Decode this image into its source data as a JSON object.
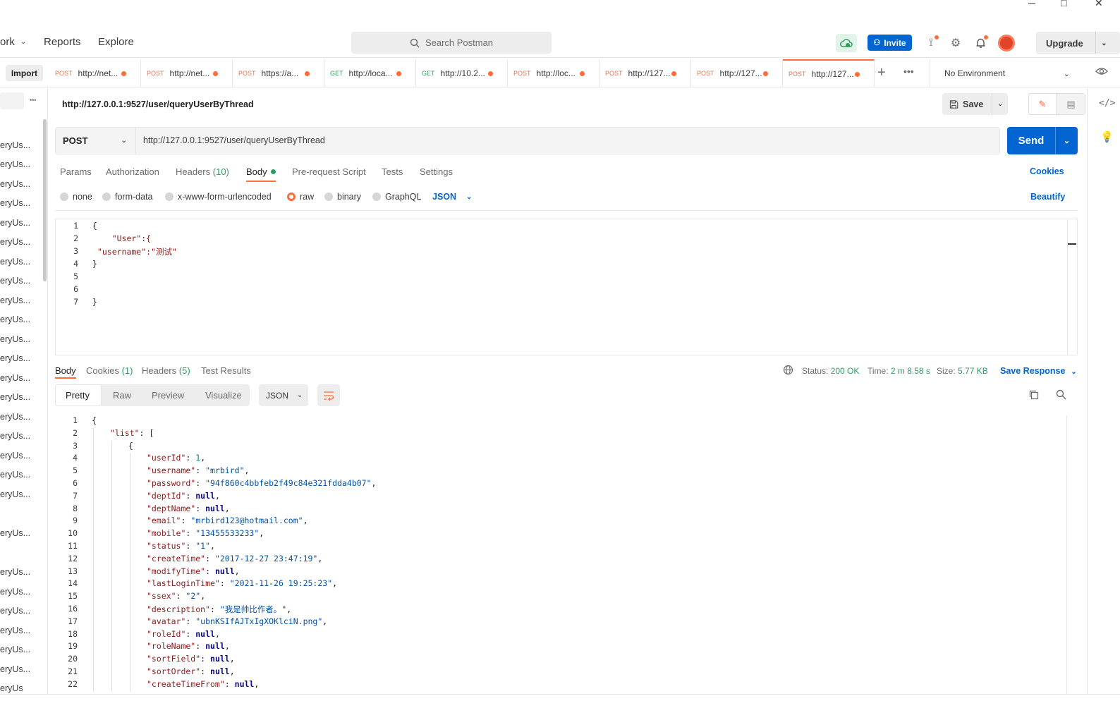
{
  "window": {
    "minimize": "─",
    "maximize": "□",
    "close": "✕"
  },
  "header": {
    "workspace": "ork",
    "reports": "Reports",
    "explore": "Explore",
    "search_placeholder": "Search Postman",
    "invite": "Invite",
    "upgrade": "Upgrade"
  },
  "tabs": {
    "import": "Import",
    "items": [
      {
        "method": "POST",
        "url": "http://net...",
        "type": "post"
      },
      {
        "method": "POST",
        "url": "http://net...",
        "type": "post"
      },
      {
        "method": "POST",
        "url": "https://a...",
        "type": "post"
      },
      {
        "method": "GET",
        "url": "http://loca...",
        "type": "get"
      },
      {
        "method": "GET",
        "url": "http://10.2...",
        "type": "get"
      },
      {
        "method": "POST",
        "url": "http://loc...",
        "type": "post"
      },
      {
        "method": "POST",
        "url": "http://127...",
        "type": "post"
      },
      {
        "method": "POST",
        "url": "http://127...",
        "type": "post"
      },
      {
        "method": "POST",
        "url": "http://127...",
        "type": "post"
      }
    ],
    "environment": "No Environment"
  },
  "sidebar": {
    "item_label": "eryUs...",
    "items": [
      "eryUs...",
      "eryUs...",
      "eryUs...",
      "eryUs...",
      "eryUs...",
      "eryUs...",
      "eryUs...",
      "eryUs...",
      "eryUs...",
      "eryUs...",
      "eryUs...",
      "eryUs...",
      "eryUs...",
      "eryUs...",
      "eryUs...",
      "eryUs...",
      "eryUs...",
      "eryUs...",
      "eryUs...",
      "eryUs...",
      "eryUs...",
      "eryUs...",
      "eryUs...",
      "eryUs...",
      "eryUs...",
      "eryUs..."
    ],
    "last": "eryUs"
  },
  "request": {
    "title": "http://127.0.0.1:9527/user/queryUserByThread",
    "save": "Save",
    "method": "POST",
    "url": "http://127.0.0.1:9527/user/queryUserByThread",
    "send": "Send",
    "tabs": {
      "params": "Params",
      "authorization": "Authorization",
      "headers": "Headers",
      "headers_count": "(10)",
      "body": "Body",
      "prerequest": "Pre-request Script",
      "tests": "Tests",
      "settings": "Settings",
      "cookies": "Cookies"
    },
    "body_types": {
      "none": "none",
      "formdata": "form-data",
      "urlencoded": "x-www-form-urlencoded",
      "raw": "raw",
      "binary": "binary",
      "graphql": "GraphQL",
      "json": "JSON",
      "beautify": "Beautify"
    },
    "body_lines": [
      "{",
      "    \"User\":{",
      " \"username\":\"测试\"",
      "}",
      "    ",
      "",
      "}"
    ]
  },
  "response": {
    "tabs": {
      "body": "Body",
      "cookies": "Cookies",
      "cookies_count": "(1)",
      "headers": "Headers",
      "headers_count": "(5)",
      "test_results": "Test Results"
    },
    "status_label": "Status:",
    "status": "200 OK",
    "time_label": "Time:",
    "time": "2 m 8.58 s",
    "size_label": "Size:",
    "size": "5.77 KB",
    "save_response": "Save Response",
    "views": {
      "pretty": "Pretty",
      "raw": "Raw",
      "preview": "Preview",
      "visualize": "Visualize",
      "format": "JSON"
    },
    "lines": [
      {
        "i": 0,
        "t": [
          [
            "p",
            "{"
          ]
        ]
      },
      {
        "i": 1,
        "t": [
          [
            "k",
            "\"list\""
          ],
          [
            "p",
            ": ["
          ]
        ]
      },
      {
        "i": 2,
        "t": [
          [
            "p",
            "{"
          ]
        ]
      },
      {
        "i": 3,
        "t": [
          [
            "k",
            "\"userId\""
          ],
          [
            "p",
            ": "
          ],
          [
            "n2",
            "1"
          ],
          [
            "p",
            ","
          ]
        ]
      },
      {
        "i": 3,
        "t": [
          [
            "k",
            "\"username\""
          ],
          [
            "p",
            ": "
          ],
          [
            "s",
            "\"mrbird\""
          ],
          [
            "p",
            ","
          ]
        ]
      },
      {
        "i": 3,
        "t": [
          [
            "k",
            "\"password\""
          ],
          [
            "p",
            ": "
          ],
          [
            "s",
            "\"94f860c4bbfeb2f49c84e321fdda4b07\""
          ],
          [
            "p",
            ","
          ]
        ]
      },
      {
        "i": 3,
        "t": [
          [
            "k",
            "\"deptId\""
          ],
          [
            "p",
            ": "
          ],
          [
            "n",
            "null"
          ],
          [
            "p",
            ","
          ]
        ]
      },
      {
        "i": 3,
        "t": [
          [
            "k",
            "\"deptName\""
          ],
          [
            "p",
            ": "
          ],
          [
            "n",
            "null"
          ],
          [
            "p",
            ","
          ]
        ]
      },
      {
        "i": 3,
        "t": [
          [
            "k",
            "\"email\""
          ],
          [
            "p",
            ": "
          ],
          [
            "s",
            "\"mrbird123@hotmail.com\""
          ],
          [
            "p",
            ","
          ]
        ]
      },
      {
        "i": 3,
        "t": [
          [
            "k",
            "\"mobile\""
          ],
          [
            "p",
            ": "
          ],
          [
            "s",
            "\"13455533233\""
          ],
          [
            "p",
            ","
          ]
        ]
      },
      {
        "i": 3,
        "t": [
          [
            "k",
            "\"status\""
          ],
          [
            "p",
            ": "
          ],
          [
            "s",
            "\"1\""
          ],
          [
            "p",
            ","
          ]
        ]
      },
      {
        "i": 3,
        "t": [
          [
            "k",
            "\"createTime\""
          ],
          [
            "p",
            ": "
          ],
          [
            "s",
            "\"2017-12-27 23:47:19\""
          ],
          [
            "p",
            ","
          ]
        ]
      },
      {
        "i": 3,
        "t": [
          [
            "k",
            "\"modifyTime\""
          ],
          [
            "p",
            ": "
          ],
          [
            "n",
            "null"
          ],
          [
            "p",
            ","
          ]
        ]
      },
      {
        "i": 3,
        "t": [
          [
            "k",
            "\"lastLoginTime\""
          ],
          [
            "p",
            ": "
          ],
          [
            "s",
            "\"2021-11-26 19:25:23\""
          ],
          [
            "p",
            ","
          ]
        ]
      },
      {
        "i": 3,
        "t": [
          [
            "k",
            "\"ssex\""
          ],
          [
            "p",
            ": "
          ],
          [
            "s",
            "\"2\""
          ],
          [
            "p",
            ","
          ]
        ]
      },
      {
        "i": 3,
        "t": [
          [
            "k",
            "\"description\""
          ],
          [
            "p",
            ": "
          ],
          [
            "s",
            "\"我是帅比作者。\""
          ],
          [
            "p",
            ","
          ]
        ]
      },
      {
        "i": 3,
        "t": [
          [
            "k",
            "\"avatar\""
          ],
          [
            "p",
            ": "
          ],
          [
            "s",
            "\"ubnKSIfAJTxIgXOKlciN.png\""
          ],
          [
            "p",
            ","
          ]
        ]
      },
      {
        "i": 3,
        "t": [
          [
            "k",
            "\"roleId\""
          ],
          [
            "p",
            ": "
          ],
          [
            "n",
            "null"
          ],
          [
            "p",
            ","
          ]
        ]
      },
      {
        "i": 3,
        "t": [
          [
            "k",
            "\"roleName\""
          ],
          [
            "p",
            ": "
          ],
          [
            "n",
            "null"
          ],
          [
            "p",
            ","
          ]
        ]
      },
      {
        "i": 3,
        "t": [
          [
            "k",
            "\"sortField\""
          ],
          [
            "p",
            ": "
          ],
          [
            "n",
            "null"
          ],
          [
            "p",
            ","
          ]
        ]
      },
      {
        "i": 3,
        "t": [
          [
            "k",
            "\"sortOrder\""
          ],
          [
            "p",
            ": "
          ],
          [
            "n",
            "null"
          ],
          [
            "p",
            ","
          ]
        ]
      },
      {
        "i": 3,
        "t": [
          [
            "k",
            "\"createTimeFrom\""
          ],
          [
            "p",
            ": "
          ],
          [
            "n",
            "null"
          ],
          [
            "p",
            ","
          ]
        ]
      }
    ]
  },
  "colors": {
    "accent": "#ff6c37",
    "primary": "#0265d2",
    "success": "#2e9d5f"
  }
}
